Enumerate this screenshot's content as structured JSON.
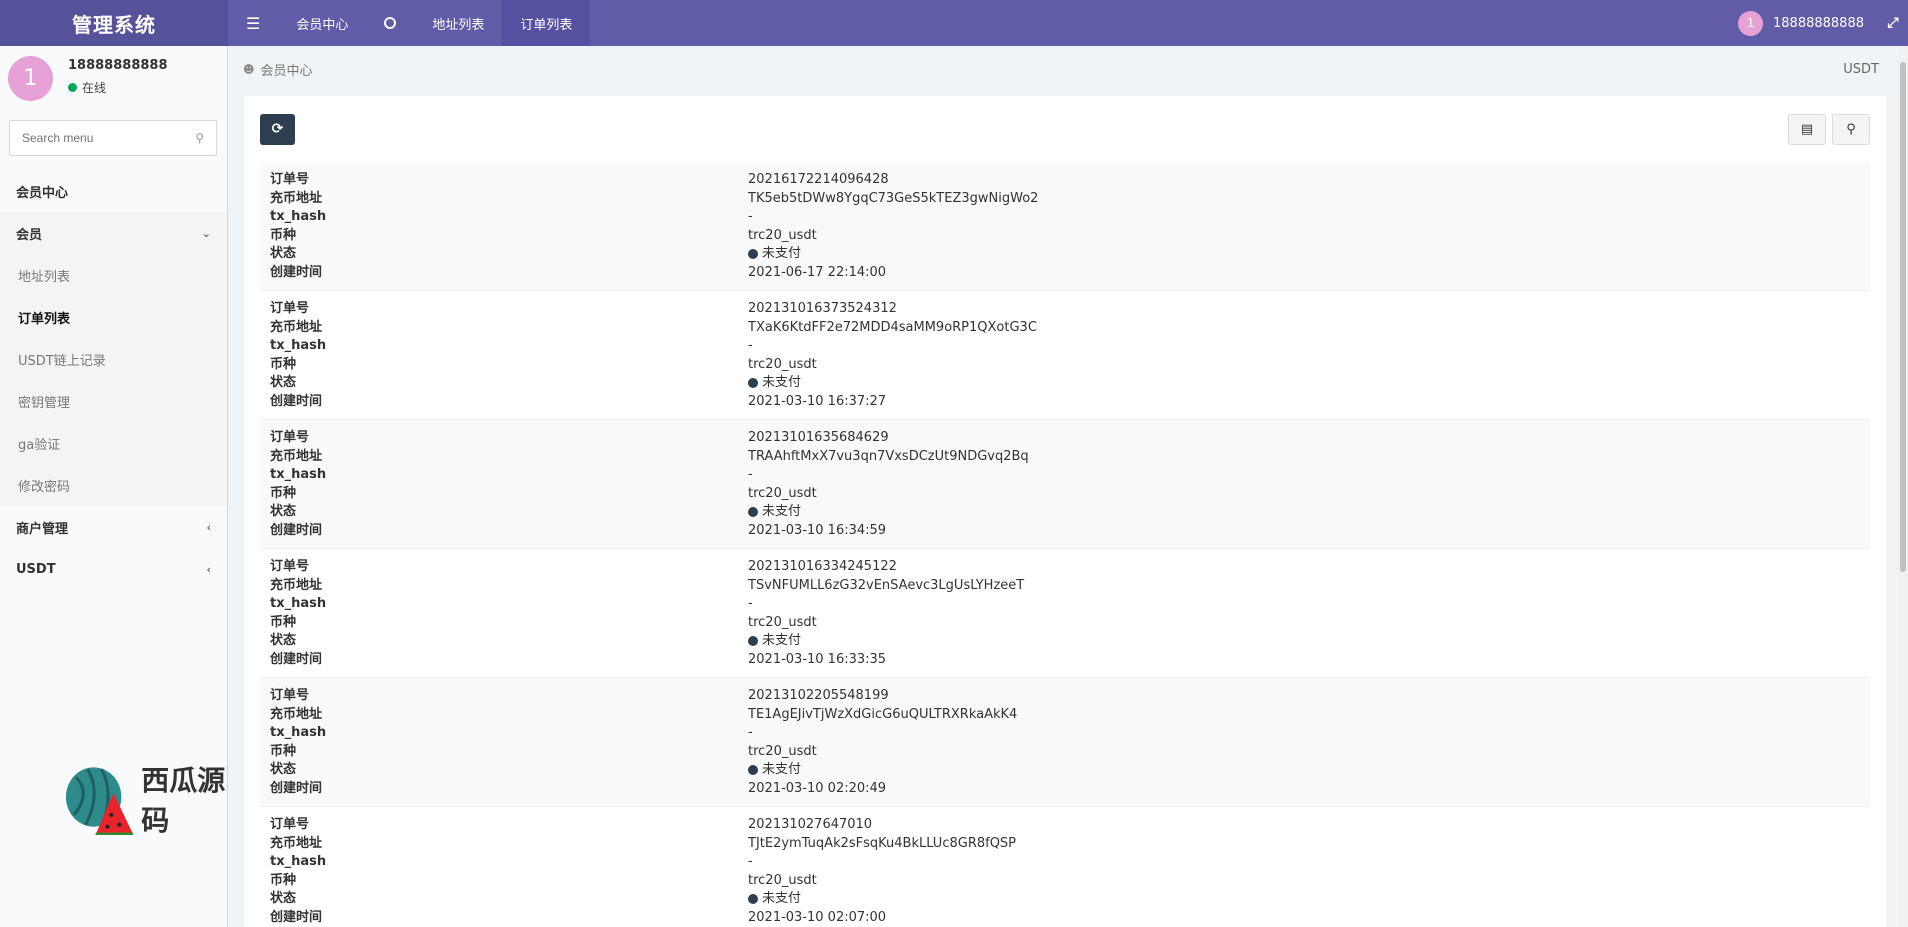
{
  "header": {
    "brand": "管理系统",
    "nav": [
      {
        "label": "会员中心"
      },
      {
        "label": "地址列表"
      },
      {
        "label": "订单列表"
      }
    ],
    "user": "18888888888",
    "avatar_letter": "1"
  },
  "sidebar": {
    "user_name": "18888888888",
    "avatar_letter": "1",
    "status": "在线",
    "search_placeholder": "Search menu",
    "menu": {
      "member_center": "会员中心",
      "member": "会员",
      "sub": [
        "地址列表",
        "订单列表",
        "USDT链上记录",
        "密钥管理",
        "ga验证",
        "修改密码"
      ],
      "merchant": "商户管理",
      "usdt": "USDT"
    }
  },
  "watermark": {
    "text": "西瓜源码"
  },
  "breadcrumb": {
    "current": "会员中心",
    "right": "USDT"
  },
  "fields": {
    "order_no": "订单号",
    "address": "充币地址",
    "tx_hash": "tx_hash",
    "coin": "币种",
    "status": "状态",
    "created": "创建时间"
  },
  "orders": [
    {
      "order_no": "20216172214096428",
      "address": "TK5eb5tDWw8YgqC73GeS5kTEZ3gwNigWo2",
      "tx_hash": "-",
      "coin": "trc20_usdt",
      "status": "未支付",
      "created": "2021-06-17 22:14:00"
    },
    {
      "order_no": "202131016373524312",
      "address": "TXaK6KtdFF2e72MDD4saMM9oRP1QXotG3C",
      "tx_hash": "-",
      "coin": "trc20_usdt",
      "status": "未支付",
      "created": "2021-03-10 16:37:27"
    },
    {
      "order_no": "20213101635684629",
      "address": "TRAAhftMxX7vu3qn7VxsDCzUt9NDGvq2Bq",
      "tx_hash": "-",
      "coin": "trc20_usdt",
      "status": "未支付",
      "created": "2021-03-10 16:34:59"
    },
    {
      "order_no": "202131016334245122",
      "address": "TSvNFUMLL6zG32vEnSAevc3LgUsLYHzeeT",
      "tx_hash": "-",
      "coin": "trc20_usdt",
      "status": "未支付",
      "created": "2021-03-10 16:33:35"
    },
    {
      "order_no": "20213102205548199",
      "address": "TE1AgEJivTjWzXdGicG6uQULTRXRkaAkK4",
      "tx_hash": "-",
      "coin": "trc20_usdt",
      "status": "未支付",
      "created": "2021-03-10 02:20:49"
    },
    {
      "order_no": "202131027647010",
      "address": "TJtE2ymTuqAk2sFsqKu4BkLLUc8GR8fQSP",
      "tx_hash": "-",
      "coin": "trc20_usdt",
      "status": "未支付",
      "created": "2021-03-10 02:07:00"
    }
  ]
}
